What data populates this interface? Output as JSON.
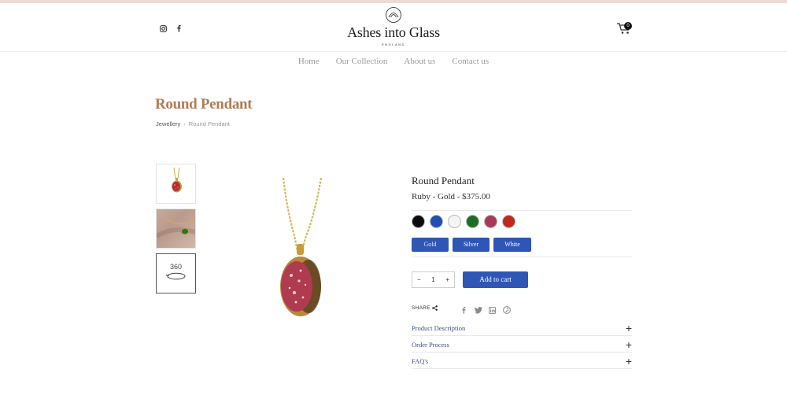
{
  "header": {
    "brand": "Ashes into Glass",
    "brand_sub": "ENGLAND",
    "cart_count": "0",
    "social_icons": [
      "instagram-icon",
      "facebook-icon"
    ]
  },
  "nav": {
    "items": [
      "Home",
      "Our Collection",
      "About us",
      "Contact us"
    ]
  },
  "page": {
    "title": "Round Pendant",
    "breadcrumb": [
      "Jewellery",
      "Round Pendant"
    ],
    "breadcrumb_sep": "›"
  },
  "product": {
    "name": "Round Pendant",
    "price_line": "Ruby - Gold - $375.00",
    "colors": [
      "#0b0b0b",
      "#1f4fb5",
      "#f4f4f4",
      "#1d6e22",
      "#a8395a",
      "#c0281c"
    ],
    "metals": [
      "Gold",
      "Silver",
      "White Gold"
    ],
    "qty_minus": "−",
    "quantity": "1",
    "qty_plus": "+",
    "add_to_cart": "Add to cart",
    "share_label": "SHARE",
    "share_icons": [
      "facebook-icon",
      "twitter-icon",
      "linkedin-icon",
      "pinterest-icon"
    ],
    "thumb_360": "360"
  },
  "accordion": [
    {
      "label": "Product Description",
      "icon": "+"
    },
    {
      "label": "Order Process",
      "icon": "+"
    },
    {
      "label": "FAQ's",
      "icon": "+"
    }
  ],
  "colors": {
    "accent": "#2f56b5",
    "title": "#b07b55",
    "topbar": "#ecdcd6"
  }
}
